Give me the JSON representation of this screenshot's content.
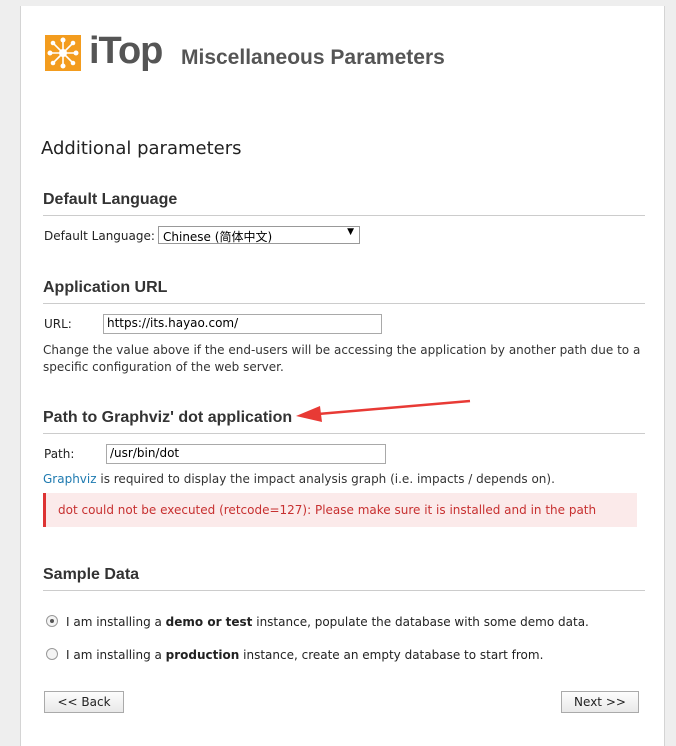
{
  "header": {
    "logo_text": "iTop",
    "title": "Miscellaneous Parameters"
  },
  "subtitle": "Additional parameters",
  "language": {
    "heading": "Default Language",
    "label": "Default Language:",
    "selected": "Chinese (简体中文)"
  },
  "app_url": {
    "heading": "Application URL",
    "label": "URL:",
    "value": "https://its.hayao.com/",
    "help_line1": "Change the value above if the end-users will be accessing the application by another path due to a",
    "help_line2": "specific configuration of the web server."
  },
  "graphviz": {
    "heading": "Path to Graphviz' dot application",
    "label": "Path:",
    "value": "/usr/bin/dot",
    "link": "Graphviz",
    "help": " is required to display the impact analysis graph (i.e. impacts / depends on).",
    "error": "dot could not be executed (retcode=127): Please make sure it is installed and in the path"
  },
  "sample": {
    "heading": "Sample Data",
    "option1": {
      "prefix": "I am installing a ",
      "bold": "demo or test",
      "suffix": " instance, populate the database with some demo data.",
      "selected": true
    },
    "option2": {
      "prefix": "I am installing a ",
      "bold": "production",
      "suffix": " instance, create an empty database to start from.",
      "selected": false
    }
  },
  "buttons": {
    "back": "<< Back",
    "next": "Next >>"
  },
  "colors": {
    "logo_orange": "#f39c1e",
    "error_red": "#c73030",
    "annotation_arrow": "#e83a35",
    "link": "#1e7ab0"
  }
}
